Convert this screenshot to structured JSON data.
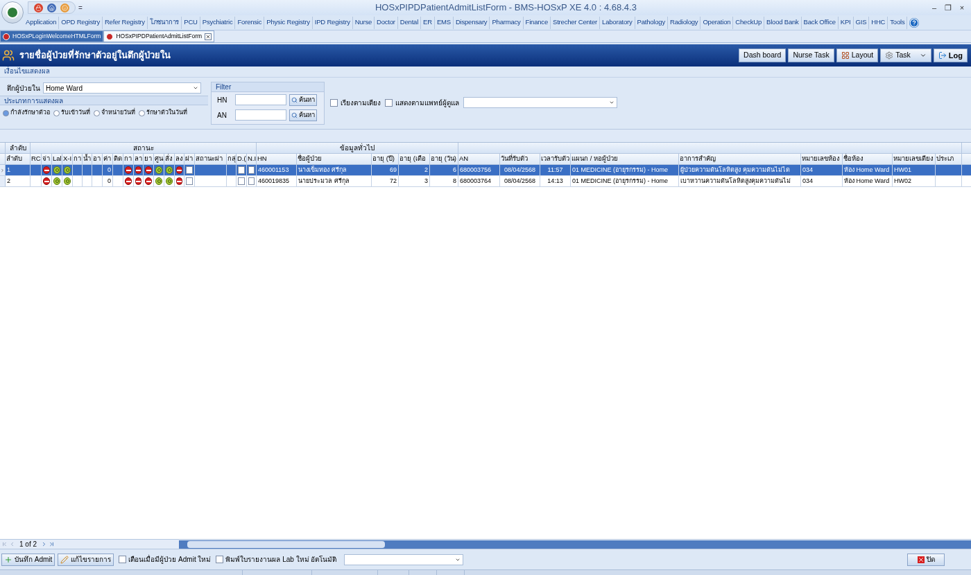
{
  "window": {
    "title": "HOSxPIPDPatientAdmitListForm - BMS-HOSxP XE 4.0 : 4.68.4.3",
    "quick_menu": "=",
    "controls": [
      "–",
      "❐",
      "×"
    ]
  },
  "menu": [
    "Application",
    "OPD Registry",
    "Refer Registry",
    "โภชนาการ",
    "PCU",
    "Psychiatric",
    "Forensic",
    "Physic Registry",
    "IPD Registry",
    "Nurse",
    "Doctor",
    "Dental",
    "ER",
    "EMS",
    "Dispensary",
    "Pharmacy",
    "Finance",
    "Strecher Center",
    "Laboratory",
    "Pathology",
    "Radiology",
    "Operation",
    "CheckUp",
    "Blood Bank",
    "Back Office",
    "KPI",
    "GIS",
    "HHC",
    "Tools"
  ],
  "doc_tabs": [
    {
      "label": "HOSxPLoginWelcomeHTMLForm",
      "selected": false
    },
    {
      "label": "HOSxPIPDPatientAdmitListForm",
      "selected": true
    }
  ],
  "header": {
    "title": "รายชื่อผู้ป่วยที่รักษาตัวอยู่ในตึกผู้ป่วยใน",
    "buttons": [
      {
        "kind": "plain",
        "label": "Dash board"
      },
      {
        "kind": "plain",
        "label": "Nurse Task"
      },
      {
        "kind": "layout",
        "label": "Layout"
      },
      {
        "kind": "task",
        "label": "Task"
      },
      {
        "kind": "log",
        "label": "Log"
      }
    ]
  },
  "conditions": {
    "title": "เงื่อนไขแสดงผล",
    "ward_label": "ตึกผู้ป่วยใน",
    "ward_value": "Home Ward",
    "display_type_title": "ประเภทการแสดงผล",
    "display_types": [
      {
        "label": "กำลังรักษาตัวอ",
        "selected": true
      },
      {
        "label": "รับเข้าวันที่",
        "selected": false
      },
      {
        "label": "จำหน่ายวันที่",
        "selected": false
      },
      {
        "label": "รักษาตัวในวันที่",
        "selected": false
      }
    ],
    "filter": {
      "title": "Filter",
      "fields": [
        {
          "label": "HN",
          "button": "ค้นหา"
        },
        {
          "label": "AN",
          "button": "ค้นหา"
        }
      ]
    },
    "options": [
      {
        "label": "เรียงตามเตียง",
        "checked": false
      },
      {
        "label": "แสดงตามแพทย์ผู้ดูแล",
        "checked": false
      }
    ]
  },
  "grid": {
    "groups": [
      {
        "label": "ลำดับ",
        "columns": [
          "ลำดับ"
        ]
      },
      {
        "label": "สถานะ",
        "columns": [
          "RC",
          "จ่า",
          "Lal",
          "X-I",
          "กา",
          "น้ำ",
          "อา",
          "ค่า",
          "ติด",
          "กา",
          "ลา",
          "ยา",
          "ศูน",
          "สั่ง",
          "ลง",
          "ผ่า",
          "สถานะผ่า",
          "กลุ่",
          "D.(",
          "N.I"
        ]
      },
      {
        "label": "ข้อมูลทั่วไป",
        "columns": [
          "HN",
          "ชื่อผู้ป่วย",
          "อายุ (ปี)",
          "อายุ (เดือ",
          "อายุ (วัน)"
        ]
      },
      {
        "columns": [
          "AN",
          "วันที่รับตัว",
          "เวลารับตัว",
          "แผนก / หอผู้ป่วย",
          "อาการสำคัญ",
          "หมายเลขห้อง",
          "ชื่อห้อง",
          "หมายเลขเตียง",
          "ประเภ"
        ]
      }
    ],
    "rows": [
      {
        "selected": true,
        "cells": [
          {
            "kind": "text",
            "text": "1"
          },
          {
            "kind": "blank"
          },
          {
            "kind": "stop"
          },
          {
            "kind": "ok"
          },
          {
            "kind": "ok"
          },
          {
            "kind": "blank"
          },
          {
            "kind": "blank"
          },
          {
            "kind": "blank"
          },
          {
            "kind": "text",
            "text": "0"
          },
          {
            "kind": "blank"
          },
          {
            "kind": "stop"
          },
          {
            "kind": "stop"
          },
          {
            "kind": "stop"
          },
          {
            "kind": "ok"
          },
          {
            "kind": "ok"
          },
          {
            "kind": "stop"
          },
          {
            "kind": "check",
            "checked": false
          },
          {
            "kind": "blank"
          },
          {
            "kind": "blank"
          },
          {
            "kind": "check",
            "checked": false
          },
          {
            "kind": "check",
            "checked": false
          },
          {
            "kind": "text",
            "text": "460001153"
          },
          {
            "kind": "text",
            "text": "นางเข็มทอง ศรีกุล"
          },
          {
            "kind": "text",
            "text": "69"
          },
          {
            "kind": "text",
            "text": "2"
          },
          {
            "kind": "text",
            "text": "6"
          },
          {
            "kind": "text",
            "text": "680003756"
          },
          {
            "kind": "text",
            "text": "08/04/2568"
          },
          {
            "kind": "text",
            "text": "11:57"
          },
          {
            "kind": "text",
            "text": "01 MEDICINE  (อายุรกรรม) - Home"
          },
          {
            "kind": "text",
            "text": "ผู้ป่วยความดันโลหิตสูง คุมความดันไม่ได"
          },
          {
            "kind": "text",
            "text": "034"
          },
          {
            "kind": "text",
            "text": "ห้อง Home Ward"
          },
          {
            "kind": "text",
            "text": "HW01"
          },
          {
            "kind": "blank"
          }
        ]
      },
      {
        "selected": false,
        "cells": [
          {
            "kind": "text",
            "text": "2"
          },
          {
            "kind": "blank"
          },
          {
            "kind": "stop"
          },
          {
            "kind": "ok"
          },
          {
            "kind": "ok"
          },
          {
            "kind": "blank"
          },
          {
            "kind": "blank"
          },
          {
            "kind": "blank"
          },
          {
            "kind": "text",
            "text": "0"
          },
          {
            "kind": "blank"
          },
          {
            "kind": "stop"
          },
          {
            "kind": "stop"
          },
          {
            "kind": "stop"
          },
          {
            "kind": "ok"
          },
          {
            "kind": "ok"
          },
          {
            "kind": "stop"
          },
          {
            "kind": "check",
            "checked": false
          },
          {
            "kind": "blank"
          },
          {
            "kind": "blank"
          },
          {
            "kind": "check",
            "checked": false
          },
          {
            "kind": "check",
            "checked": false
          },
          {
            "kind": "text",
            "text": "460019835"
          },
          {
            "kind": "text",
            "text": "นายประมวล ศรีกุล"
          },
          {
            "kind": "text",
            "text": "72"
          },
          {
            "kind": "text",
            "text": "3"
          },
          {
            "kind": "text",
            "text": "8"
          },
          {
            "kind": "text",
            "text": "680003764"
          },
          {
            "kind": "text",
            "text": "08/04/2568"
          },
          {
            "kind": "text",
            "text": "14:13"
          },
          {
            "kind": "text",
            "text": "01 MEDICINE  (อายุรกรรม) - Home"
          },
          {
            "kind": "text",
            "text": "เบาหวานความดันโลหิตสูงคุมความดันไม่"
          },
          {
            "kind": "text",
            "text": "034"
          },
          {
            "kind": "text",
            "text": "ห้อง Home Ward"
          },
          {
            "kind": "text",
            "text": "HW02"
          },
          {
            "kind": "blank"
          }
        ]
      }
    ],
    "pager": "1 of 2"
  },
  "footer": {
    "buttons": [
      {
        "kind": "add",
        "label": "บันทึก Admit"
      },
      {
        "kind": "edit",
        "label": "แก้ไขรายการ"
      }
    ],
    "options": [
      {
        "label": "เตือนเมื่อมีผู้ป่วย Admit ใหม่",
        "checked": false
      },
      {
        "label": "พิมพ์ใบรายงานผล Lab ใหม่ อัตโนมัติ",
        "checked": false
      }
    ],
    "close": "ปิด"
  }
}
